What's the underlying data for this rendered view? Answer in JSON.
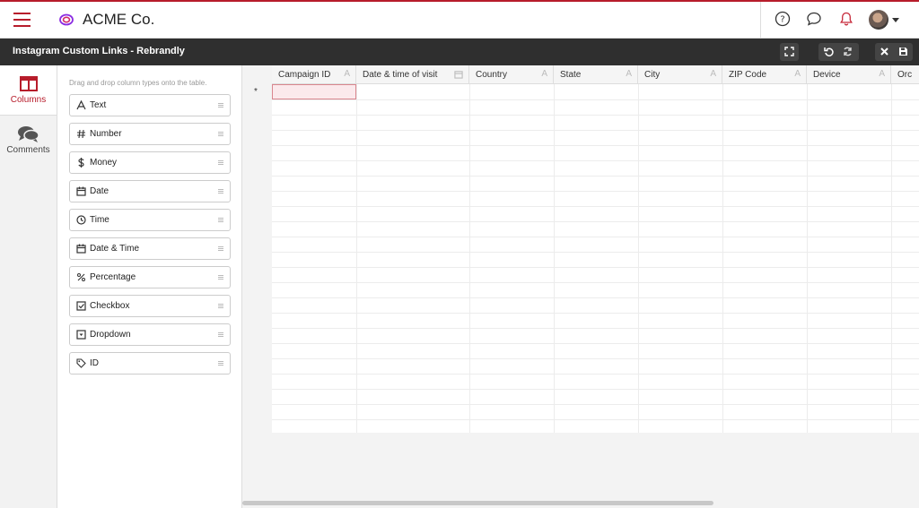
{
  "app": {
    "brand": "ACME Co."
  },
  "titlebar": {
    "title": "Instagram Custom Links - Rebrandly"
  },
  "rail": {
    "items": [
      {
        "label": "Columns",
        "icon": "columns-icon"
      },
      {
        "label": "Comments",
        "icon": "comments-icon"
      }
    ]
  },
  "panel": {
    "hint": "Drag and drop column types onto the table.",
    "types": [
      {
        "label": "Text",
        "icon": "text-icon"
      },
      {
        "label": "Number",
        "icon": "hash-icon"
      },
      {
        "label": "Money",
        "icon": "dollar-icon"
      },
      {
        "label": "Date",
        "icon": "calendar-icon"
      },
      {
        "label": "Time",
        "icon": "clock-icon"
      },
      {
        "label": "Date & Time",
        "icon": "calendar-icon"
      },
      {
        "label": "Percentage",
        "icon": "percent-icon"
      },
      {
        "label": "Checkbox",
        "icon": "checkbox-icon"
      },
      {
        "label": "Dropdown",
        "icon": "dropdown-icon"
      },
      {
        "label": "ID",
        "icon": "tag-icon"
      }
    ]
  },
  "grid": {
    "row_marker": "*",
    "columns": [
      {
        "label": "Campaign ID",
        "type_glyph": "A"
      },
      {
        "label": "Date & time of visit",
        "type_glyph": ""
      },
      {
        "label": "Country",
        "type_glyph": "A"
      },
      {
        "label": "State",
        "type_glyph": "A"
      },
      {
        "label": "City",
        "type_glyph": "A"
      },
      {
        "label": "ZIP Code",
        "type_glyph": "A"
      },
      {
        "label": "Device",
        "type_glyph": "A"
      },
      {
        "label": "Orc",
        "type_glyph": ""
      }
    ]
  },
  "colors": {
    "accent": "#b71c2b",
    "titlebar": "#2f2f2f"
  }
}
